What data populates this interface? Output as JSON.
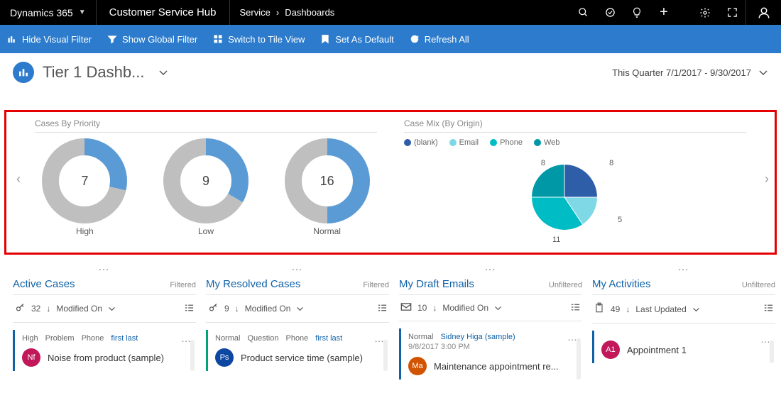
{
  "top": {
    "brand": "Dynamics 365",
    "hub": "Customer Service Hub",
    "bc1": "Service",
    "bc2": "Dashboards"
  },
  "cmds": {
    "hide": "Hide Visual Filter",
    "global": "Show Global Filter",
    "tile": "Switch to Tile View",
    "default": "Set As Default",
    "refresh": "Refresh All"
  },
  "header": {
    "title": "Tier 1 Dashb...",
    "range": "This Quarter 7/1/2017 - 9/30/2017"
  },
  "charts": {
    "priority_title": "Cases By Priority",
    "mix_title": "Case Mix (By Origin)",
    "legend": {
      "blank": "(blank)",
      "email": "Email",
      "phone": "Phone",
      "web": "Web"
    }
  },
  "chart_data": [
    {
      "type": "pie",
      "title": "Cases By Priority",
      "series": [
        {
          "name": "High",
          "total": 7,
          "slices": [
            {
              "color": "#5b9bd5",
              "value": 2
            },
            {
              "color": "#bfbfbf",
              "value": 5
            }
          ]
        },
        {
          "name": "Low",
          "total": 9,
          "slices": [
            {
              "color": "#5b9bd5",
              "value": 3
            },
            {
              "color": "#bfbfbf",
              "value": 6
            }
          ]
        },
        {
          "name": "Normal",
          "total": 16,
          "slices": [
            {
              "color": "#5b9bd5",
              "value": 8
            },
            {
              "color": "#bfbfbf",
              "value": 8
            }
          ]
        }
      ]
    },
    {
      "type": "pie",
      "title": "Case Mix (By Origin)",
      "categories": [
        "(blank)",
        "Email",
        "Phone",
        "Web"
      ],
      "values": [
        8,
        5,
        11,
        8
      ],
      "colors": [
        "#2f5ea8",
        "#7fd8e6",
        "#00bcc4",
        "#0097a7"
      ]
    }
  ],
  "streams": [
    {
      "name": "Active Cases",
      "filter": "Filtered",
      "count": "32",
      "sort": "Modified On",
      "icon": "key",
      "card": {
        "border": "blue",
        "tags": [
          "High",
          "Problem",
          "Phone"
        ],
        "link": "first last",
        "avColor": "#c2185b",
        "avText": "Nf",
        "title": "Noise from product (sample)"
      }
    },
    {
      "name": "My Resolved Cases",
      "filter": "Filtered",
      "count": "9",
      "sort": "Modified On",
      "icon": "key",
      "card": {
        "border": "green",
        "tags": [
          "Normal",
          "Question",
          "Phone"
        ],
        "link": "first last",
        "avColor": "#0d47a1",
        "avText": "Ps",
        "title": "Product service time (sample)"
      }
    },
    {
      "name": "My Draft Emails",
      "filter": "Unfiltered",
      "count": "10",
      "sort": "Modified On",
      "icon": "mail",
      "card": {
        "border": "blue",
        "tags": [
          "Normal"
        ],
        "link": "Sidney Higa (sample)",
        "sub": "9/8/2017 3:00 PM",
        "avColor": "#d35400",
        "avText": "Ma",
        "title": "Maintenance appointment re..."
      }
    },
    {
      "name": "My Activities",
      "filter": "Unfiltered",
      "count": "49",
      "sort": "Last Updated",
      "icon": "clip",
      "card": {
        "border": "blue",
        "tags": [],
        "avColor": "#c2185b",
        "avText": "A1",
        "title": "Appointment 1"
      }
    }
  ]
}
